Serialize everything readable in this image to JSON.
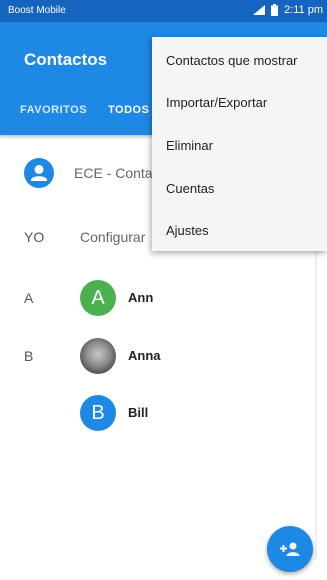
{
  "status_bar": {
    "carrier": "Boost Mobile",
    "time": "2:11 pm"
  },
  "app_bar": {
    "title": "Contactos"
  },
  "tabs": [
    {
      "label": "FAVORITOS"
    },
    {
      "label": "TODOS"
    }
  ],
  "me_row": {
    "text": "ECE - Conta"
  },
  "yo_row": {
    "section": "YO",
    "text": "Configurar"
  },
  "contacts": [
    {
      "section": "A",
      "initial": "A",
      "name": "Ann",
      "color": "#4caf50"
    },
    {
      "section": "B",
      "initial": "",
      "name": "Anna",
      "color": "#777777"
    },
    {
      "section": "",
      "initial": "B",
      "name": "Bill",
      "color": "#1e88e5"
    }
  ],
  "overflow_menu": {
    "items": [
      {
        "label": "Contactos que mostrar"
      },
      {
        "label": "Importar/Exportar"
      },
      {
        "label": "Eliminar"
      },
      {
        "label": "Cuentas"
      },
      {
        "label": "Ajustes"
      }
    ]
  },
  "icons": {
    "signal": "signal-icon",
    "battery": "battery-icon",
    "me": "person-icon",
    "fab": "add-contact-icon"
  },
  "colors": {
    "primary": "#1e88e5",
    "status_bar": "#1565c0"
  }
}
